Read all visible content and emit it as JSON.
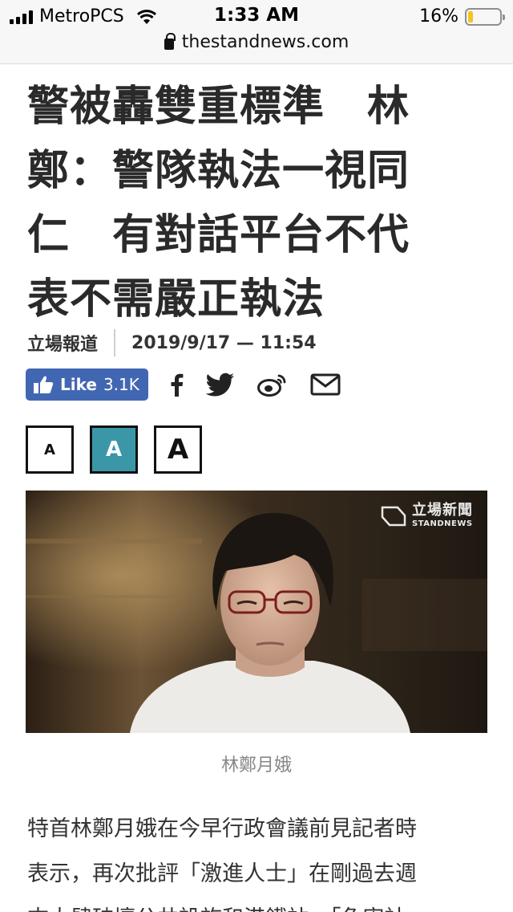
{
  "status_bar": {
    "carrier": "MetroPCS",
    "time": "1:33 AM",
    "battery": "16%",
    "battery_level": 0.16,
    "url": "thestandnews.com"
  },
  "article": {
    "headline_lines": [
      "警被轟雙重標準　林",
      "鄭：警隊執法一視同",
      "仁　有對話平台不代",
      "表不需嚴正執法"
    ],
    "source": "立場報道",
    "datetime": "2019/9/17 — 11:54",
    "like_label": "Like",
    "like_count": "3.1K",
    "share_icons": [
      "facebook-icon",
      "twitter-icon",
      "weibo-icon",
      "email-icon"
    ],
    "font_size_buttons": [
      "A",
      "A",
      "A"
    ],
    "watermark": {
      "zh": "立場新聞",
      "en": "STANDNEWS"
    },
    "photo_caption": "林鄭月娥",
    "body_lines": [
      "特首林鄭月娥在今早行政會議前見記者時",
      "表示，再次批評「激進人士」在剛過去週",
      "末大肆破壞公共設施和港鐵站，「危害社"
    ]
  },
  "colors": {
    "facebook_blue": "#4267b2",
    "font_btn_active": "#3b97a8",
    "battery_yellow": "#f4c321"
  }
}
